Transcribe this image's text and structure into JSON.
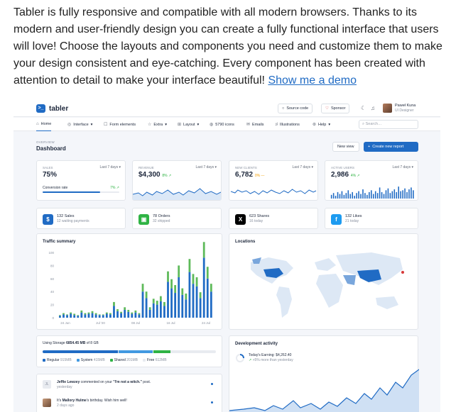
{
  "intro": {
    "text": "Tabler is fully responsive and compatible with all modern browsers. Thanks to its modern and user-friendly design you can create a fully functional interface that users will love! Choose the layouts and components you need and customize them to make your design consistent and eye-catching. Every component has been created with attention to detail to make your interface beautiful!",
    "link": "Show me a demo"
  },
  "app": {
    "logo": "tabler",
    "source_code": "Source code",
    "sponsor": "Sponsor",
    "user_name": "Paweł Kuna",
    "user_role": "UI Designer",
    "nav": [
      "Home",
      "Interface",
      "Form elements",
      "Extra",
      "Layout",
      "5790 icons",
      "Emails",
      "Illustrations",
      "Help"
    ],
    "search_placeholder": "Search…",
    "pretitle": "OVERVIEW",
    "title": "Dashboard",
    "new_view": "New view",
    "create_report": "Create new report"
  },
  "stats": [
    {
      "label": "SALES",
      "period": "Last 7 days",
      "value": "75%",
      "delta": "",
      "conv_label": "Conversion rate",
      "conv_delta": "7%",
      "progress": 0.75
    },
    {
      "label": "REVENUE",
      "period": "Last 7 days",
      "value": "$4,300",
      "delta": "8%"
    },
    {
      "label": "NEW CLIENTS",
      "period": "Last 7 days",
      "value": "6,782",
      "delta": "0%"
    },
    {
      "label": "ACTIVE USERS",
      "period": "Last 7 days",
      "value": "2,986",
      "delta": "4%"
    }
  ],
  "summary": [
    {
      "title": "132 Sales",
      "sub": "12 waiting payments",
      "color": "#206bc4",
      "glyph": "$"
    },
    {
      "title": "78 Orders",
      "sub": "32 shipped",
      "color": "#2fb344",
      "glyph": "▣"
    },
    {
      "title": "623 Shares",
      "sub": "16 today",
      "color": "#000000",
      "glyph": "X"
    },
    {
      "title": "132 Likes",
      "sub": "21 today",
      "color": "#1d9bf0",
      "glyph": "f"
    }
  ],
  "traffic": {
    "title": "Traffic summary",
    "yticks": [
      "100",
      "80",
      "60",
      "40",
      "20",
      "0"
    ],
    "xticks": [
      "24 Jun",
      "Jul '20",
      "08 Jul",
      "16 Jul",
      "24 Jul"
    ]
  },
  "locations": {
    "title": "Locations"
  },
  "storage": {
    "label": "Using Storage",
    "used": "6854.45 MB",
    "of": "of 8 GB",
    "segments": [
      {
        "name": "Regular",
        "size": "915MB",
        "color": "#206bc4",
        "frac": 0.44
      },
      {
        "name": "System",
        "size": "415MB",
        "color": "#4299e1",
        "frac": 0.2
      },
      {
        "name": "Shared",
        "size": "201MB",
        "color": "#2fb344",
        "frac": 0.1
      },
      {
        "name": "Free",
        "size": "612MB",
        "color": "#e8ebf0",
        "frac": 0.26
      }
    ]
  },
  "activity": [
    {
      "initials": "JL",
      "who": "Jeffie Lewzey",
      "text": "commented on your",
      "quote": "\"I'm not a witch.\"",
      "tail": "post.",
      "when": "yesterday"
    },
    {
      "initials": "",
      "who": "",
      "text": "It's",
      "quote": "Mallory Hulme",
      "tail": "'s birthday. Wish him well!",
      "when": "2 days ago"
    }
  ],
  "dev": {
    "title": "Development activity",
    "earning": "Today's Earning: $4,262.40",
    "change": "+5% more than yesterday"
  },
  "chart_data": [
    {
      "type": "bar",
      "title": "Traffic summary",
      "ylim": [
        0,
        100
      ],
      "series": [
        {
          "name": "",
          "values": [
            3,
            5,
            4,
            6,
            4,
            3,
            8,
            5,
            6,
            7,
            5,
            4,
            4,
            6,
            5,
            18,
            10,
            7,
            12,
            9,
            6,
            8,
            5,
            40,
            30,
            12,
            22,
            20,
            25,
            18,
            55,
            45,
            38,
            62,
            35,
            28,
            70,
            52,
            48,
            30,
            92,
            60,
            40
          ]
        },
        {
          "name": "",
          "values": [
            1,
            2,
            1,
            2,
            2,
            1,
            3,
            2,
            2,
            3,
            2,
            1,
            1,
            2,
            2,
            6,
            3,
            2,
            4,
            3,
            2,
            3,
            2,
            12,
            10,
            4,
            7,
            6,
            8,
            6,
            16,
            14,
            12,
            18,
            10,
            9,
            20,
            15,
            14,
            9,
            24,
            18,
            12
          ]
        }
      ]
    }
  ]
}
